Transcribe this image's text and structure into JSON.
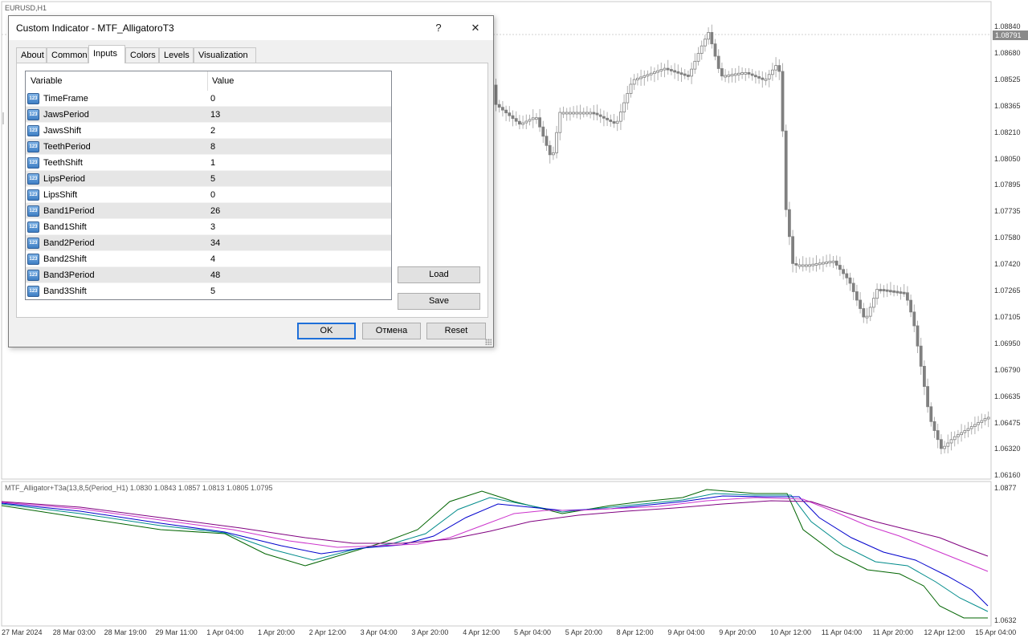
{
  "chart": {
    "symbol_label": "EURUSD,H1",
    "current_price": "1.08791",
    "price_labels": [
      "1.08840",
      "1.08680",
      "1.08525",
      "1.08365",
      "1.08210",
      "1.08050",
      "1.07895",
      "1.07735",
      "1.07580",
      "1.07420",
      "1.07265",
      "1.07105",
      "1.06950",
      "1.06790",
      "1.06635",
      "1.06475",
      "1.06320",
      "1.06160"
    ],
    "time_labels": [
      "27 Mar 2024",
      "28 Mar 03:00",
      "28 Mar 19:00",
      "29 Mar 11:00",
      "1 Apr 04:00",
      "1 Apr 20:00",
      "2 Apr 12:00",
      "3 Apr 04:00",
      "3 Apr 20:00",
      "4 Apr 12:00",
      "5 Apr 04:00",
      "5 Apr 20:00",
      "8 Apr 12:00",
      "9 Apr 04:00",
      "9 Apr 20:00",
      "10 Apr 12:00",
      "11 Apr 04:00",
      "11 Apr 20:00",
      "12 Apr 12:00",
      "15 Apr 04:00"
    ],
    "indicator_label": "MTF_Alligator+T3a(13,8,5(Period_H1) 1.0830 1.0843 1.0857 1.0813 1.0805 1.0795",
    "indicator_scale": [
      "1.0877",
      "1.0632"
    ],
    "colors": {
      "bars": "#808080",
      "line1": "#006400",
      "line2": "#008b8b",
      "line3": "#0000cd",
      "line4": "#cc33cc",
      "line5": "#800080",
      "grid": "#e0e0e0"
    }
  },
  "dialog": {
    "title": "Custom Indicator - MTF_AlligatoroT3",
    "help_icon": "?",
    "close_icon": "✕",
    "tabs": [
      "About",
      "Common",
      "Inputs",
      "Colors",
      "Levels",
      "Visualization"
    ],
    "active_tab": "Inputs",
    "columns": [
      "Variable",
      "Value"
    ],
    "type_icon_text": "123",
    "rows": [
      {
        "variable": "TimeFrame",
        "value": "0"
      },
      {
        "variable": "JawsPeriod",
        "value": "13"
      },
      {
        "variable": "JawsShift",
        "value": "2"
      },
      {
        "variable": "TeethPeriod",
        "value": "8"
      },
      {
        "variable": "TeethShift",
        "value": "1"
      },
      {
        "variable": "LipsPeriod",
        "value": "5"
      },
      {
        "variable": "LipsShift",
        "value": "0"
      },
      {
        "variable": "Band1Period",
        "value": "26"
      },
      {
        "variable": "Band1Shift",
        "value": "3"
      },
      {
        "variable": "Band2Period",
        "value": "34"
      },
      {
        "variable": "Band2Shift",
        "value": "4"
      },
      {
        "variable": "Band3Period",
        "value": "48"
      },
      {
        "variable": "Band3Shift",
        "value": "5"
      }
    ],
    "load_label": "Load",
    "save_label": "Save",
    "ok_label": "OK",
    "cancel_label": "Отмена",
    "reset_label": "Reset"
  }
}
